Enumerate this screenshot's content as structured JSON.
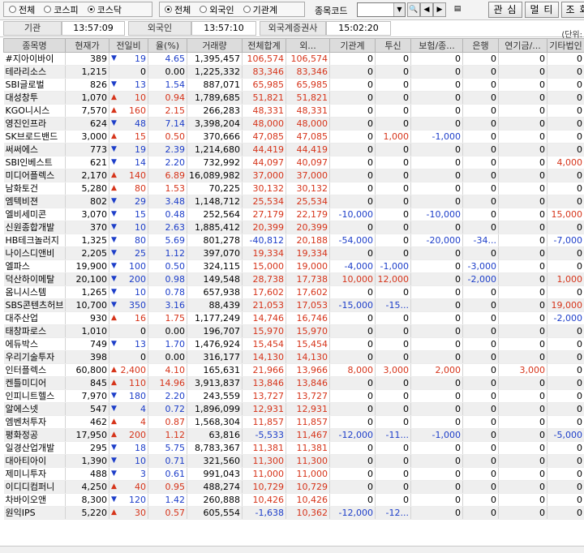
{
  "market_filter": {
    "options": [
      {
        "label": "전체",
        "selected": false
      },
      {
        "label": "코스피",
        "selected": false
      },
      {
        "label": "코스닥",
        "selected": true
      }
    ]
  },
  "investor_filter": {
    "options": [
      {
        "label": "전체",
        "selected": true
      },
      {
        "label": "외국인",
        "selected": false
      },
      {
        "label": "기관계",
        "selected": false
      }
    ]
  },
  "code": {
    "label": "종목코드",
    "value": ""
  },
  "buttons": {
    "interest": "관 심",
    "multi": "멀 티",
    "query": "조 회"
  },
  "times": [
    {
      "label": "기관",
      "value": "13:57:09"
    },
    {
      "label": "외국인",
      "value": "13:57:10"
    },
    {
      "label": "외국계증권사",
      "value": "15:02:20"
    }
  ],
  "unit_label": "(단위:",
  "columns": [
    "종목명",
    "현재가",
    "전일비",
    "율(%)",
    "거래량",
    "전체합계",
    "외...",
    "기관계",
    "투신",
    "보험/종...",
    "은행",
    "연기금/...",
    "기타법인"
  ],
  "colors": {
    "up": "#d6341a",
    "down": "#1d3ec9",
    "row_alt": "#efefef"
  },
  "rows": [
    {
      "name": "#지아이바이",
      "price": "389",
      "dir": "down",
      "change": "19",
      "rate": "4.65",
      "volume": "1,395,457",
      "total": "106,574",
      "foreign": "106,574",
      "inst": "0",
      "trust": "0",
      "insure": "0",
      "bank": "0",
      "pension": "0",
      "other": "0"
    },
    {
      "name": "테라리소스",
      "price": "1,215",
      "dir": "none",
      "change": "0",
      "rate": "0.00",
      "volume": "1,225,332",
      "total": "83,346",
      "foreign": "83,346",
      "inst": "0",
      "trust": "0",
      "insure": "0",
      "bank": "0",
      "pension": "0",
      "other": "0"
    },
    {
      "name": "SBI글로벌",
      "price": "826",
      "dir": "down",
      "change": "13",
      "rate": "1.54",
      "volume": "887,071",
      "total": "65,985",
      "foreign": "65,985",
      "inst": "0",
      "trust": "0",
      "insure": "0",
      "bank": "0",
      "pension": "0",
      "other": "0"
    },
    {
      "name": "대성창투",
      "price": "1,070",
      "dir": "up",
      "change": "10",
      "rate": "0.94",
      "volume": "1,789,685",
      "total": "51,821",
      "foreign": "51,821",
      "inst": "0",
      "trust": "0",
      "insure": "0",
      "bank": "0",
      "pension": "0",
      "other": "0"
    },
    {
      "name": "KGO니시스",
      "price": "7,570",
      "dir": "up",
      "change": "160",
      "rate": "2.15",
      "volume": "266,283",
      "total": "48,331",
      "foreign": "48,331",
      "inst": "0",
      "trust": "0",
      "insure": "0",
      "bank": "0",
      "pension": "0",
      "other": "0"
    },
    {
      "name": "영진인프라",
      "price": "624",
      "dir": "down",
      "change": "48",
      "rate": "7.14",
      "volume": "3,398,204",
      "total": "48,000",
      "foreign": "48,000",
      "inst": "0",
      "trust": "0",
      "insure": "0",
      "bank": "0",
      "pension": "0",
      "other": "0"
    },
    {
      "name": "SK브로드밴드",
      "price": "3,000",
      "dir": "up",
      "change": "15",
      "rate": "0.50",
      "volume": "370,666",
      "total": "47,085",
      "foreign": "47,085",
      "inst": "0",
      "trust": "1,000",
      "insure": "-1,000",
      "bank": "0",
      "pension": "0",
      "other": "0"
    },
    {
      "name": "써써에스",
      "price": "773",
      "dir": "down",
      "change": "19",
      "rate": "2.39",
      "volume": "1,214,680",
      "total": "44,419",
      "foreign": "44,419",
      "inst": "0",
      "trust": "0",
      "insure": "0",
      "bank": "0",
      "pension": "0",
      "other": "0"
    },
    {
      "name": "SBI인베스트",
      "price": "621",
      "dir": "down",
      "change": "14",
      "rate": "2.20",
      "volume": "732,992",
      "total": "44,097",
      "foreign": "40,097",
      "inst": "0",
      "trust": "0",
      "insure": "0",
      "bank": "0",
      "pension": "0",
      "other": "4,000"
    },
    {
      "name": "미디어플렉스",
      "price": "2,170",
      "dir": "up",
      "change": "140",
      "rate": "6.89",
      "volume": "16,089,982",
      "total": "37,000",
      "foreign": "37,000",
      "inst": "0",
      "trust": "0",
      "insure": "0",
      "bank": "0",
      "pension": "0",
      "other": "0"
    },
    {
      "name": "남화토건",
      "price": "5,280",
      "dir": "up",
      "change": "80",
      "rate": "1.53",
      "volume": "70,225",
      "total": "30,132",
      "foreign": "30,132",
      "inst": "0",
      "trust": "0",
      "insure": "0",
      "bank": "0",
      "pension": "0",
      "other": "0"
    },
    {
      "name": "엠텍비젼",
      "price": "802",
      "dir": "down",
      "change": "29",
      "rate": "3.48",
      "volume": "1,148,712",
      "total": "25,534",
      "foreign": "25,534",
      "inst": "0",
      "trust": "0",
      "insure": "0",
      "bank": "0",
      "pension": "0",
      "other": "0"
    },
    {
      "name": "엘비세미콘",
      "price": "3,070",
      "dir": "down",
      "change": "15",
      "rate": "0.48",
      "volume": "252,564",
      "total": "27,179",
      "foreign": "22,179",
      "inst": "-10,000",
      "trust": "0",
      "insure": "-10,000",
      "bank": "0",
      "pension": "0",
      "other": "15,000"
    },
    {
      "name": "신원종합개발",
      "price": "370",
      "dir": "down",
      "change": "10",
      "rate": "2.63",
      "volume": "1,885,412",
      "total": "20,399",
      "foreign": "20,399",
      "inst": "0",
      "trust": "0",
      "insure": "0",
      "bank": "0",
      "pension": "0",
      "other": "0"
    },
    {
      "name": "HB테크놀러지",
      "price": "1,325",
      "dir": "down",
      "change": "80",
      "rate": "5.69",
      "volume": "801,278",
      "total": "-40,812",
      "foreign": "20,188",
      "inst": "-54,000",
      "trust": "0",
      "insure": "-20,000",
      "bank": "-34...",
      "pension": "0",
      "other": "-7,000"
    },
    {
      "name": "나이스디앤비",
      "price": "2,205",
      "dir": "down",
      "change": "25",
      "rate": "1.12",
      "volume": "397,070",
      "total": "19,334",
      "foreign": "19,334",
      "inst": "0",
      "trust": "0",
      "insure": "0",
      "bank": "0",
      "pension": "0",
      "other": "0"
    },
    {
      "name": "엘파스",
      "price": "19,900",
      "dir": "down",
      "change": "100",
      "rate": "0.50",
      "volume": "324,115",
      "total": "15,000",
      "foreign": "19,000",
      "inst": "-4,000",
      "trust": "-1,000",
      "insure": "0",
      "bank": "-3,000",
      "pension": "0",
      "other": "0"
    },
    {
      "name": "덕산하이메탈",
      "price": "20,100",
      "dir": "down",
      "change": "200",
      "rate": "0.98",
      "volume": "149,548",
      "total": "28,738",
      "foreign": "17,738",
      "inst": "10,000",
      "trust": "12,000",
      "insure": "0",
      "bank": "-2,000",
      "pension": "0",
      "other": "1,000"
    },
    {
      "name": "옴니시스템",
      "price": "1,265",
      "dir": "down",
      "change": "10",
      "rate": "0.78",
      "volume": "657,938",
      "total": "17,602",
      "foreign": "17,602",
      "inst": "0",
      "trust": "0",
      "insure": "0",
      "bank": "0",
      "pension": "0",
      "other": "0"
    },
    {
      "name": "SBS콘텐츠허브",
      "price": "10,700",
      "dir": "down",
      "change": "350",
      "rate": "3.16",
      "volume": "88,439",
      "total": "21,053",
      "foreign": "17,053",
      "inst": "-15,000",
      "trust": "-15...",
      "insure": "0",
      "bank": "0",
      "pension": "0",
      "other": "19,000"
    },
    {
      "name": "대주산업",
      "price": "930",
      "dir": "up",
      "change": "16",
      "rate": "1.75",
      "volume": "1,177,249",
      "total": "14,746",
      "foreign": "16,746",
      "inst": "0",
      "trust": "0",
      "insure": "0",
      "bank": "0",
      "pension": "0",
      "other": "-2,000"
    },
    {
      "name": "태창파로스",
      "price": "1,010",
      "dir": "none",
      "change": "0",
      "rate": "0.00",
      "volume": "196,707",
      "total": "15,970",
      "foreign": "15,970",
      "inst": "0",
      "trust": "0",
      "insure": "0",
      "bank": "0",
      "pension": "0",
      "other": "0"
    },
    {
      "name": "에듀박스",
      "price": "749",
      "dir": "down",
      "change": "13",
      "rate": "1.70",
      "volume": "1,476,924",
      "total": "15,454",
      "foreign": "15,454",
      "inst": "0",
      "trust": "0",
      "insure": "0",
      "bank": "0",
      "pension": "0",
      "other": "0"
    },
    {
      "name": "우리기술투자",
      "price": "398",
      "dir": "none",
      "change": "0",
      "rate": "0.00",
      "volume": "316,177",
      "total": "14,130",
      "foreign": "14,130",
      "inst": "0",
      "trust": "0",
      "insure": "0",
      "bank": "0",
      "pension": "0",
      "other": "0"
    },
    {
      "name": "인터플렉스",
      "price": "60,800",
      "dir": "up",
      "change": "2,400",
      "rate": "4.10",
      "volume": "165,631",
      "total": "21,966",
      "foreign": "13,966",
      "inst": "8,000",
      "trust": "3,000",
      "insure": "2,000",
      "bank": "0",
      "pension": "3,000",
      "other": "0"
    },
    {
      "name": "켄틀미디어",
      "price": "845",
      "dir": "up",
      "change": "110",
      "rate": "14.96",
      "volume": "3,913,837",
      "total": "13,846",
      "foreign": "13,846",
      "inst": "0",
      "trust": "0",
      "insure": "0",
      "bank": "0",
      "pension": "0",
      "other": "0"
    },
    {
      "name": "인피니트헬스",
      "price": "7,970",
      "dir": "down",
      "change": "180",
      "rate": "2.20",
      "volume": "243,559",
      "total": "13,727",
      "foreign": "13,727",
      "inst": "0",
      "trust": "0",
      "insure": "0",
      "bank": "0",
      "pension": "0",
      "other": "0"
    },
    {
      "name": "알에스넷",
      "price": "547",
      "dir": "down",
      "change": "4",
      "rate": "0.72",
      "volume": "1,896,099",
      "total": "12,931",
      "foreign": "12,931",
      "inst": "0",
      "trust": "0",
      "insure": "0",
      "bank": "0",
      "pension": "0",
      "other": "0"
    },
    {
      "name": "엠벤처투자",
      "price": "462",
      "dir": "up",
      "change": "4",
      "rate": "0.87",
      "volume": "1,568,304",
      "total": "11,857",
      "foreign": "11,857",
      "inst": "0",
      "trust": "0",
      "insure": "0",
      "bank": "0",
      "pension": "0",
      "other": "0"
    },
    {
      "name": "평화정공",
      "price": "17,950",
      "dir": "up",
      "change": "200",
      "rate": "1.12",
      "volume": "63,816",
      "total": "-5,533",
      "foreign": "11,467",
      "inst": "-12,000",
      "trust": "-11...",
      "insure": "-1,000",
      "bank": "0",
      "pension": "0",
      "other": "-5,000"
    },
    {
      "name": "일경산업개발",
      "price": "295",
      "dir": "down",
      "change": "18",
      "rate": "5.75",
      "volume": "8,783,367",
      "total": "11,381",
      "foreign": "11,381",
      "inst": "0",
      "trust": "0",
      "insure": "0",
      "bank": "0",
      "pension": "0",
      "other": "0"
    },
    {
      "name": "대아티아이",
      "price": "1,390",
      "dir": "down",
      "change": "10",
      "rate": "0.71",
      "volume": "321,560",
      "total": "11,300",
      "foreign": "11,300",
      "inst": "0",
      "trust": "0",
      "insure": "0",
      "bank": "0",
      "pension": "0",
      "other": "0"
    },
    {
      "name": "제미니투자",
      "price": "488",
      "dir": "down",
      "change": "3",
      "rate": "0.61",
      "volume": "991,043",
      "total": "11,000",
      "foreign": "11,000",
      "inst": "0",
      "trust": "0",
      "insure": "0",
      "bank": "0",
      "pension": "0",
      "other": "0"
    },
    {
      "name": "이디디컴퍼니",
      "price": "4,250",
      "dir": "up",
      "change": "40",
      "rate": "0.95",
      "volume": "488,274",
      "total": "10,729",
      "foreign": "10,729",
      "inst": "0",
      "trust": "0",
      "insure": "0",
      "bank": "0",
      "pension": "0",
      "other": "0"
    },
    {
      "name": "차바이오앤",
      "price": "8,300",
      "dir": "down",
      "change": "120",
      "rate": "1.42",
      "volume": "260,888",
      "total": "10,426",
      "foreign": "10,426",
      "inst": "0",
      "trust": "0",
      "insure": "0",
      "bank": "0",
      "pension": "0",
      "other": "0"
    },
    {
      "name": "원익IPS",
      "price": "5,220",
      "dir": "up",
      "change": "30",
      "rate": "0.57",
      "volume": "605,554",
      "total": "-1,638",
      "foreign": "10,362",
      "inst": "-12,000",
      "trust": "-12...",
      "insure": "0",
      "bank": "0",
      "pension": "0",
      "other": "0"
    }
  ]
}
